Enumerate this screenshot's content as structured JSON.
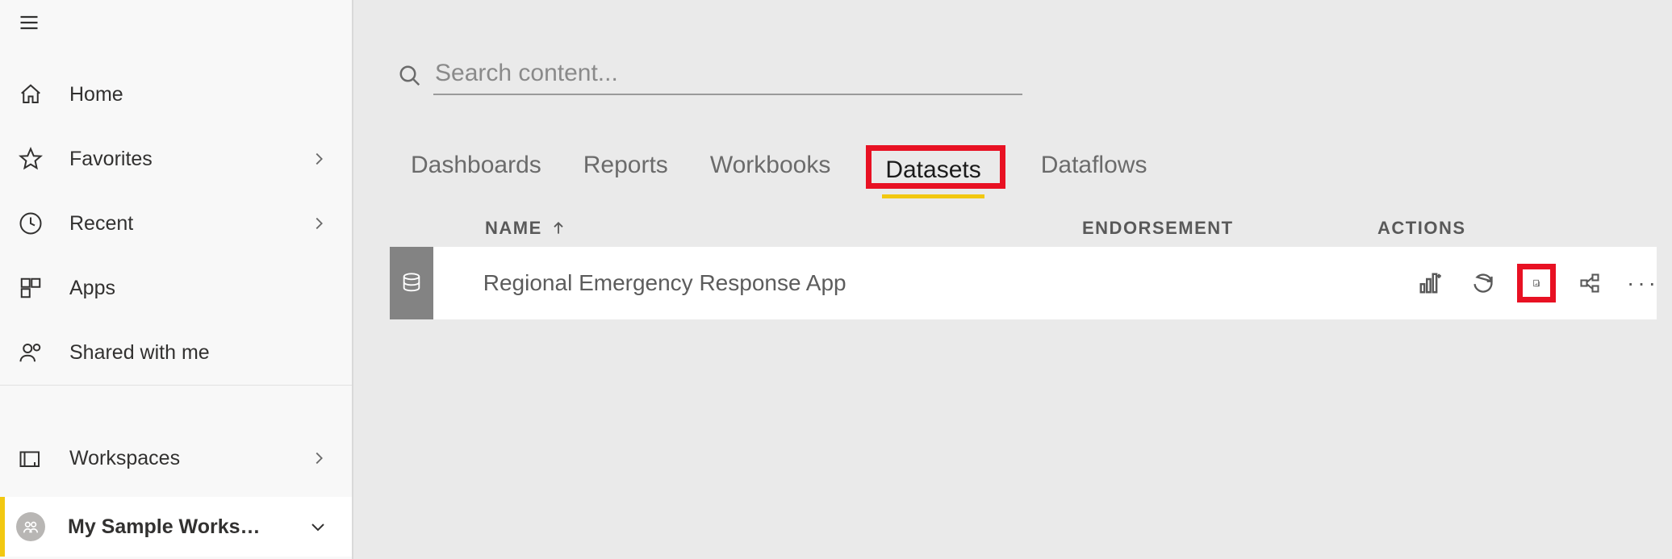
{
  "sidebar": {
    "items": [
      {
        "label": "Home"
      },
      {
        "label": "Favorites"
      },
      {
        "label": "Recent"
      },
      {
        "label": "Apps"
      },
      {
        "label": "Shared with me"
      }
    ],
    "workspaces_label": "Workspaces",
    "current_workspace": "My Sample Works…"
  },
  "search": {
    "placeholder": "Search content..."
  },
  "tabs": [
    {
      "label": "Dashboards",
      "active": false
    },
    {
      "label": "Reports",
      "active": false
    },
    {
      "label": "Workbooks",
      "active": false
    },
    {
      "label": "Datasets",
      "active": true
    },
    {
      "label": "Dataflows",
      "active": false
    }
  ],
  "columns": {
    "name": "NAME",
    "endorsement": "ENDORSEMENT",
    "actions": "ACTIONS"
  },
  "rows": [
    {
      "name": "Regional Emergency Response App"
    }
  ],
  "highlight": {
    "tab_index": 3,
    "action": "schedule-refresh"
  }
}
